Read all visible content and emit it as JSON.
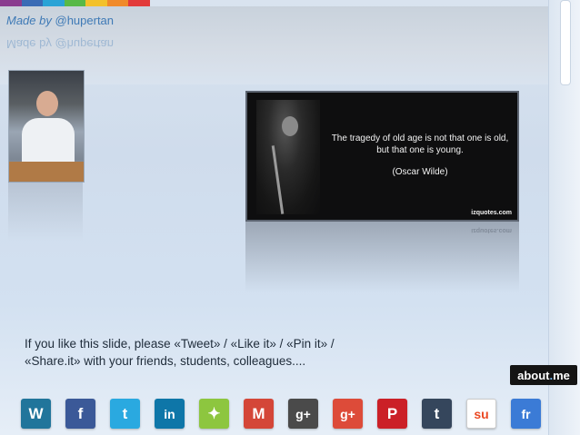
{
  "top_bar": {
    "colors": [
      "#8a3c8f",
      "#3a6bb5",
      "#2aa3d6",
      "#58b947",
      "#f3c12b",
      "#f08a2a",
      "#e23a3a"
    ]
  },
  "header": {
    "made_by_prefix": "Made by",
    "made_by_handle": "@hupertan",
    "made_by_mirror": "Made by @hupertan"
  },
  "quote": {
    "text": "The tragedy of old age is not that one is old, but that one is young.",
    "author": "(Oscar Wilde)",
    "source": "izquotes.com",
    "source_mirror": "izquotes.com"
  },
  "cta": {
    "line1": "If you like this slide, please «Tweet» / «Like it» / «Pin it» /",
    "line2": "«Share.it» with your friends, students, colleagues...."
  },
  "about_me": {
    "label_main": "about",
    "label_dot": ".",
    "label_tail": "me"
  },
  "share_icons": [
    {
      "name": "wordpress-icon",
      "glyph": "W",
      "bg": "#21759b"
    },
    {
      "name": "facebook-icon",
      "glyph": "f",
      "bg": "#3b5998"
    },
    {
      "name": "twitter-icon",
      "glyph": "t",
      "bg": "#2aa9e0"
    },
    {
      "name": "linkedin-icon",
      "glyph": "in",
      "bg": "#0e76a8"
    },
    {
      "name": "google-maps-icon",
      "glyph": "✦",
      "bg": "#8dc63f"
    },
    {
      "name": "gmail-icon",
      "glyph": "M",
      "bg": "#d44638"
    },
    {
      "name": "google-plus-dark-icon",
      "glyph": "g+",
      "bg": "#4a4a4a"
    },
    {
      "name": "google-plus-icon",
      "glyph": "g+",
      "bg": "#dd4b39"
    },
    {
      "name": "pinterest-icon",
      "glyph": "P",
      "bg": "#cb2027"
    },
    {
      "name": "tumblr-icon",
      "glyph": "t",
      "bg": "#35465c"
    },
    {
      "name": "stumbleupon-icon",
      "glyph": "su",
      "bg": "#ffffff"
    },
    {
      "name": "friendfeed-icon",
      "glyph": "fr",
      "bg": "#3b7bd6"
    }
  ]
}
